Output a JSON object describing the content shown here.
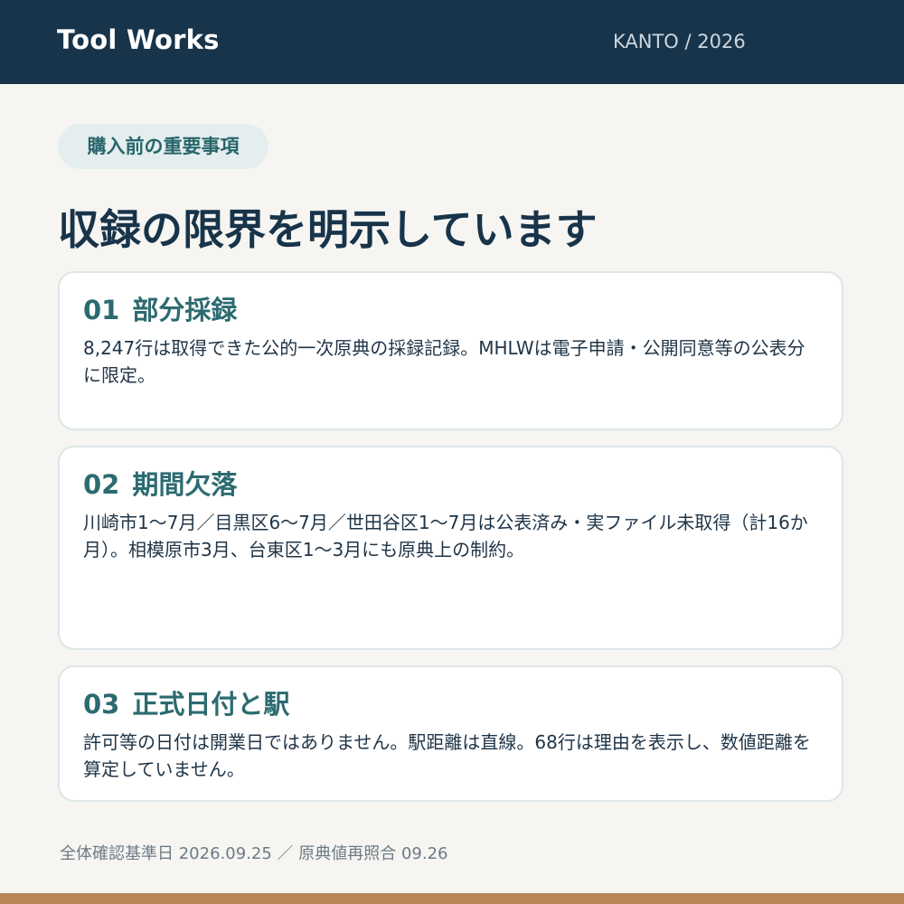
{
  "header": {
    "brand": "Tool Works",
    "region": "KANTO / 2026"
  },
  "tag": "購入前の重要事項",
  "title": "収録の限界を明示しています",
  "cards": [
    {
      "number": "01",
      "heading": "部分採録",
      "body": "8,247行は取得できた公的一次原典の採録記録。MHLWは電子申請・公開同意等の公表分に限定。"
    },
    {
      "number": "02",
      "heading": "期間欠落",
      "body": "川崎市1〜7月／目黒区6〜7月／世田谷区1〜7月は公表済み・実ファイル未取得（計16か月）。相模原市3月、台東区1〜3月にも原典上の制約。"
    },
    {
      "number": "03",
      "heading": "正式日付と駅",
      "body": "許可等の日付は開業日ではありません。駅距離は直線。68行は理由を表示し、数値距離を算定していません。"
    }
  ],
  "footnote": "全体確認基準日 2026.09.25 ／ 原典値再照合 09.26"
}
